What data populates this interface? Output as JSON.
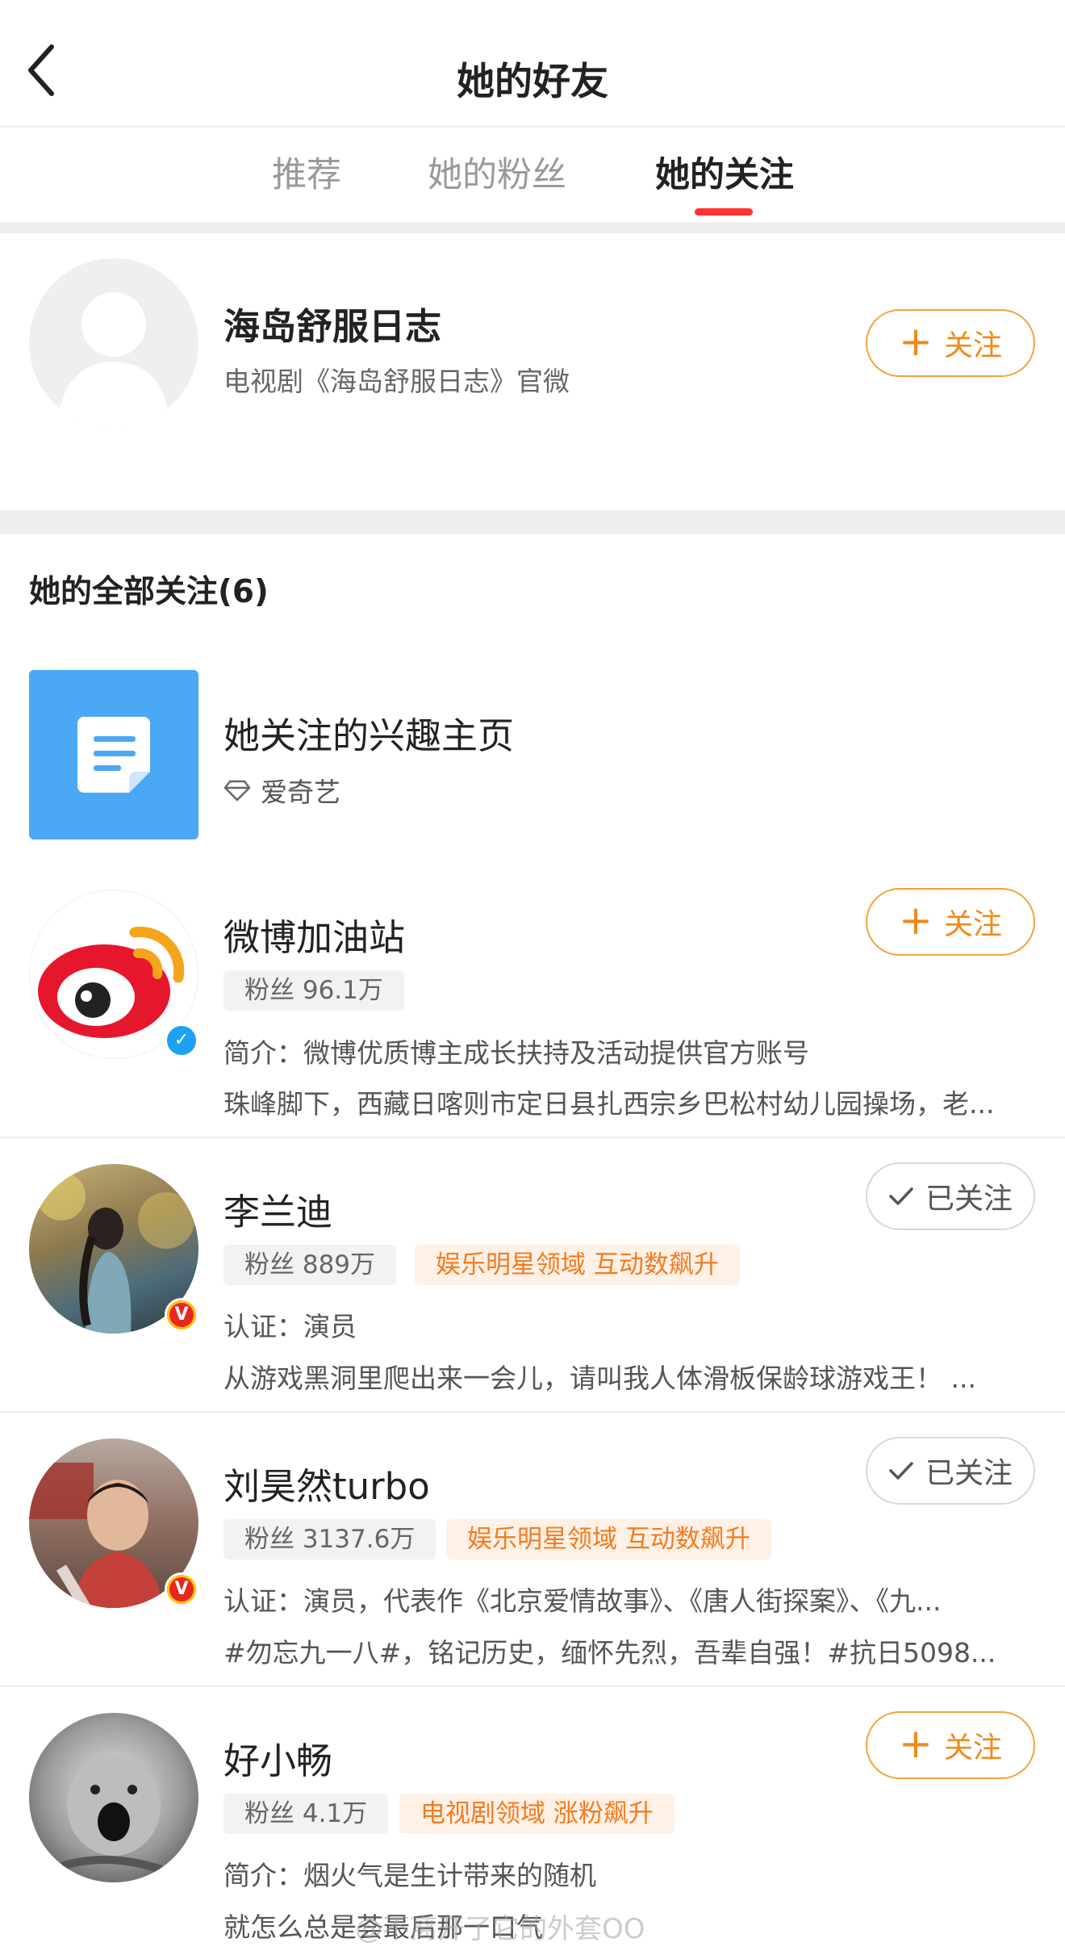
{
  "header": {
    "title": "她的好友"
  },
  "tabs": [
    {
      "label": "推荐",
      "active": false
    },
    {
      "label": "她的粉丝",
      "active": false
    },
    {
      "label": "她的关注",
      "active": true
    }
  ],
  "colors": {
    "accent": "#ff3333",
    "follow_orange": "#f08a1a",
    "tag_orange": "#f47a1f",
    "verified_blue": "#1da1f2",
    "verified_red": "#e8261f"
  },
  "featured": {
    "name": "海岛舒服日志",
    "desc": "电视剧《海岛舒服日志》官微",
    "button": "关注",
    "avatar_icon": "default-avatar-icon"
  },
  "all_follows": {
    "title": "她的全部关注(6)"
  },
  "interest_page": {
    "title": "她关注的兴趣主页",
    "sub_icon": "diamond-icon",
    "sub": "爱奇艺"
  },
  "users": [
    {
      "name": "微博加油站",
      "fans": "粉丝 96.1万",
      "tag": "",
      "line1": "简介：微博优质博主成长扶持及活动提供官方账号",
      "line2": "珠峰脚下，西藏日喀则市定日县扎西宗乡巴松村幼儿园操场，老...",
      "button": "关注",
      "followed": false,
      "verified": "blue-v-icon"
    },
    {
      "name": "李兰迪",
      "fans": "粉丝 889万",
      "tag": "娱乐明星领域 互动数飙升",
      "line1": "认证：演员",
      "line2": "从游戏黑洞里爬出来一会儿，请叫我人体滑板保龄球游戏王！ ...",
      "button": "已关注",
      "followed": true,
      "verified": "gold-v-icon"
    },
    {
      "name": "刘昊然turbo",
      "fans": "粉丝 3137.6万",
      "tag": "娱乐明星领域 互动数飙升",
      "line1": "认证：演员，代表作《北京爱情故事》、《唐人街探案》、《九...",
      "line2": "#勿忘九一八#，铭记历史，缅怀先烈，吾辈自强！#抗日5098...",
      "button": "已关注",
      "followed": true,
      "verified": "gold-v-icon"
    },
    {
      "name": "好小畅",
      "fans": "粉丝 4.1万",
      "tag": "电视剧领域 涨粉飙升",
      "line1": "简介：烟火气是生计带来的随机",
      "line2": "就怎么总是荟最后那一口气",
      "button": "关注",
      "followed": false,
      "verified": ""
    }
  ],
  "watermark": "@不离开了它的外套OO"
}
